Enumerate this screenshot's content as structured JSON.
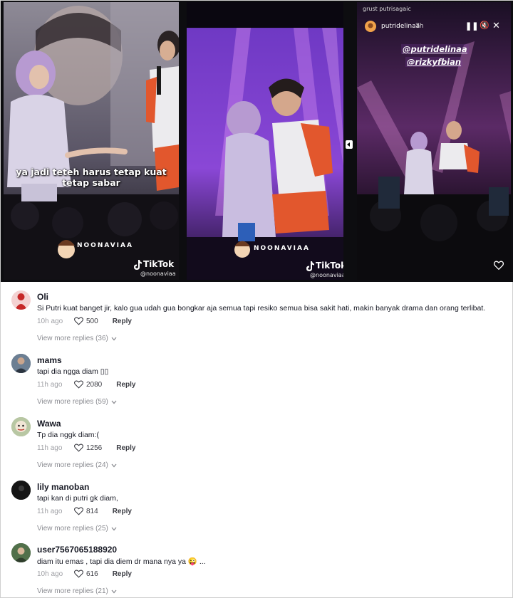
{
  "video": {
    "panel1": {
      "caption_line1": "ya jadi teteh harus tetap kuat",
      "caption_line2": "tetap sabar",
      "watermark": "NOONAVIAA",
      "brand": "TikTok",
      "handle": "@noonaviaa"
    },
    "panel2": {
      "watermark": "NOONAVIAA",
      "brand": "TikTok",
      "handle": "@noonaviaa"
    },
    "panel3": {
      "top_text": "grust  putrisagaic",
      "story_user": "putridelinaa",
      "story_time": "7h",
      "tag1": "@putridelinaa",
      "tag2": "@rizkyfbian"
    }
  },
  "comments": [
    {
      "name": "Oli",
      "text": "Si Putri kuat banget jir, kalo gua udah gua bongkar aja semua tapi resiko semua bisa sakit hati, makin banyak drama dan orang terlibat.",
      "time": "10h ago",
      "likes": "500",
      "reply": "Reply",
      "more": "View more replies (36)",
      "avatar_color": "#c62828",
      "avatar_icon": "red-figure-avatar"
    },
    {
      "name": "mams",
      "text": "tapi dia ngga diam ▯▯",
      "time": "11h ago",
      "likes": "2080",
      "reply": "Reply",
      "more": "View more replies (59)",
      "avatar_color": "#4a5a6e",
      "avatar_icon": "photo-avatar"
    },
    {
      "name": "Wawa",
      "text": "Tp dia nggk diam:(",
      "time": "11h ago",
      "likes": "1256",
      "reply": "Reply",
      "more": "View more replies (24)",
      "avatar_color": "#9caf8a",
      "avatar_icon": "cartoon-avatar"
    },
    {
      "name": "lily manoban",
      "text": "tapi kan di putri gk diam,",
      "time": "11h ago",
      "likes": "814",
      "reply": "Reply",
      "more": "View more replies (25)",
      "avatar_color": "#141414",
      "avatar_icon": "dark-avatar"
    },
    {
      "name": "user7567065188920",
      "text": "diam itu emas , tapi dia diem dr mana nya ya 😜 ...",
      "time": "10h ago",
      "likes": "616",
      "reply": "Reply",
      "more": "View more replies (21)",
      "avatar_color": "#3f5a3a",
      "avatar_icon": "photo-avatar"
    }
  ]
}
